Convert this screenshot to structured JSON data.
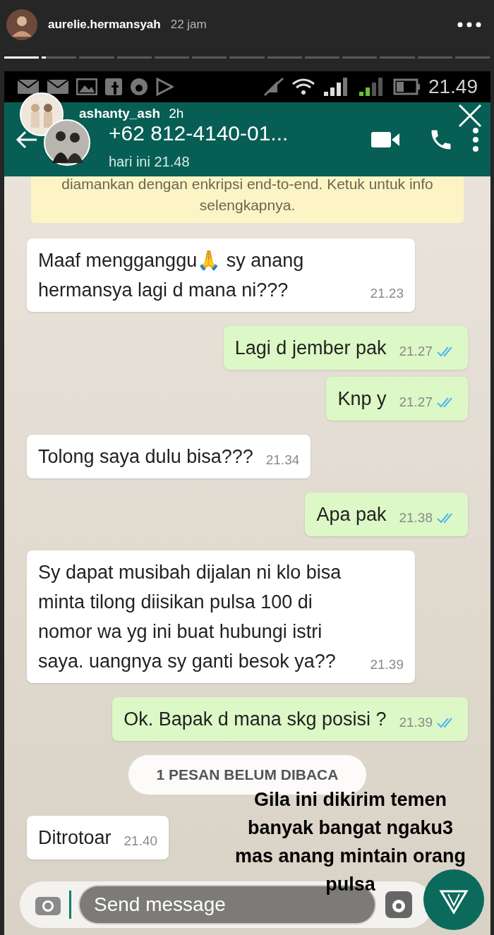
{
  "story": {
    "username": "aurelie.hermansyah",
    "time": "22 jam",
    "segments": [
      {
        "level": 1
      },
      {
        "level": 0.12
      },
      {
        "level": 0
      },
      {
        "level": 0
      },
      {
        "level": 0
      },
      {
        "level": 0
      },
      {
        "level": 0
      },
      {
        "level": 0
      },
      {
        "level": 0
      },
      {
        "level": 0
      },
      {
        "level": 0
      },
      {
        "level": 0
      },
      {
        "level": 0
      }
    ]
  },
  "status_bar": {
    "time": "21.49"
  },
  "overlay_user": {
    "username": "ashanty_ash",
    "time": "2h"
  },
  "chat_header": {
    "contact": "+62 812-4140-01...",
    "last_seen": "hari ini 21.48"
  },
  "encryption_notice": "diamankan dengan enkripsi end-to-end. Ketuk untuk info selengkapnya.",
  "messages": [
    {
      "kind": "in",
      "text": "Maaf mengganggu🙏 sy anang hermansya lagi d mana ni???",
      "time": "21.23",
      "read": false
    },
    {
      "kind": "out",
      "text": "Lagi d jember pak",
      "time": "21.27",
      "read": true
    },
    {
      "kind": "out",
      "text": "Knp y",
      "time": "21.27",
      "read": true
    },
    {
      "kind": "in",
      "text": "Tolong saya dulu bisa???",
      "time": "21.34",
      "read": false
    },
    {
      "kind": "out",
      "text": "Apa pak",
      "time": "21.38",
      "read": true
    },
    {
      "kind": "in",
      "text": "Sy dapat musibah dijalan ni klo bisa minta tilong diisikan pulsa 100 di nomor wa yg ini buat hubungi istri saya. uangnya sy ganti besok ya??",
      "time": "21.39",
      "read": false
    },
    {
      "kind": "out",
      "text": "Ok. Bapak d mana skg posisi ?",
      "time": "21.39",
      "read": true
    },
    {
      "kind": "unread",
      "text": "1 PESAN BELUM DIBACA"
    },
    {
      "kind": "in",
      "text": "Ditrotoar",
      "time": "21.40",
      "read": false
    }
  ],
  "caption": "Gila ini dikirim temen banyak bangat ngaku3 mas anang mintain orang pulsa",
  "reply_field": {
    "placeholder": "Send message"
  }
}
